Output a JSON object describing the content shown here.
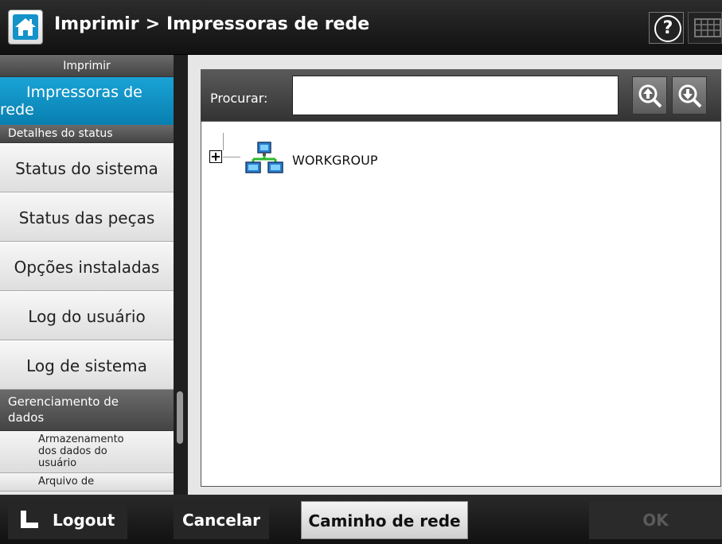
{
  "header": {
    "breadcrumb_parent": "Imprimir",
    "breadcrumb_separator": ">",
    "breadcrumb_current": "Impressoras de rede",
    "help_label": "?",
    "icons": {
      "home": "home-icon",
      "help": "help-icon",
      "keyboard": "keyboard-icon"
    }
  },
  "sidebar": {
    "section_print": "Imprimir",
    "active_item_line1": "Impressoras de",
    "active_item_line2": "rede",
    "section_status": "Detalhes do status",
    "items": [
      {
        "label": "Status do sistema"
      },
      {
        "label": "Status das peças"
      },
      {
        "label": "Opções instaladas"
      },
      {
        "label": "Log do usuário"
      },
      {
        "label": "Log de sistema"
      }
    ],
    "section_data_line1": "Gerenciamento de",
    "section_data_line2": "dados",
    "sub_items": [
      {
        "label_lines": [
          "Armazenamento",
          "dos dados do",
          "usuário"
        ]
      },
      {
        "label_lines": [
          "Arquivo de"
        ]
      }
    ]
  },
  "search": {
    "label": "Procurar:",
    "value": "",
    "icons": {
      "up": "search-up-icon",
      "down": "search-down-icon"
    }
  },
  "tree": {
    "nodes": [
      {
        "label": "WORKGROUP",
        "icon": "network-workgroup-icon",
        "expanded": false
      }
    ]
  },
  "footer": {
    "logout_label": "Logout",
    "cancel_label": "Cancelar",
    "network_path_label": "Caminho de rede",
    "ok_label": "OK",
    "ok_enabled": false
  },
  "colors": {
    "accent": "#0a8dc4",
    "header_bg": "#1c1c1c",
    "sidebar_bg": "#e8e8e8"
  }
}
